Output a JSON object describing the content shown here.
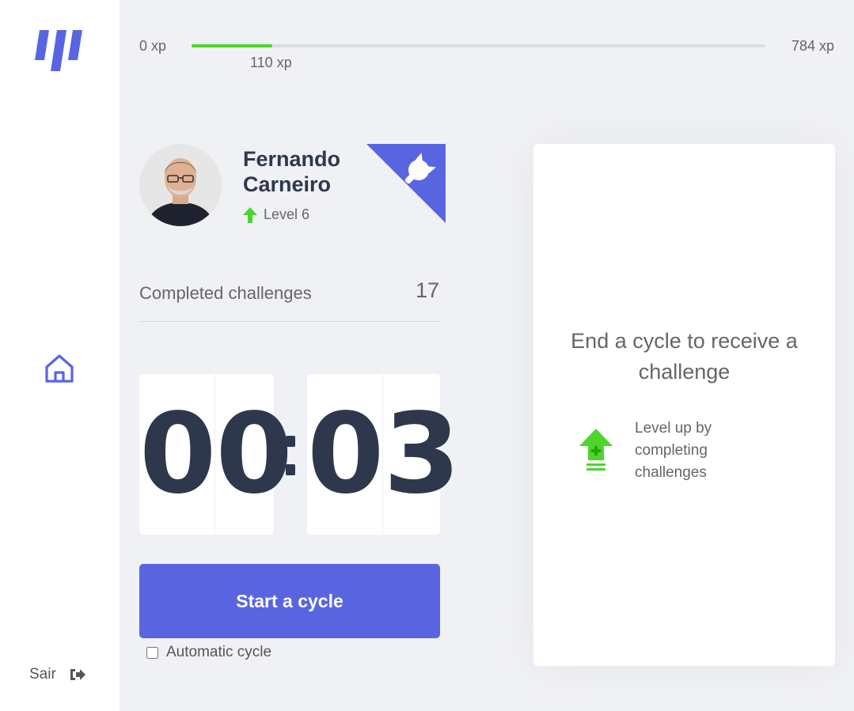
{
  "sidebar": {
    "logout_label": "Sair"
  },
  "xp": {
    "min_label": "0 xp",
    "max_label": "784 xp",
    "current_label": "110 xp",
    "progress_fraction": 0.14
  },
  "profile": {
    "name": "Fernando Carneiro",
    "level_label": "Level 6"
  },
  "completed": {
    "label": "Completed challenges",
    "value": "17"
  },
  "countdown": {
    "minute_left": "0",
    "minute_right": "0",
    "second_left": "0",
    "second_right": "3"
  },
  "actions": {
    "start_label": "Start a cycle",
    "auto_cycle_label": "Automatic cycle",
    "auto_cycle_checked": false
  },
  "challenge": {
    "title": "End a cycle to receive a challenge",
    "hint": "Level up by completing challenges"
  },
  "colors": {
    "accent": "#5965e0",
    "green": "#4cd62b",
    "title_text": "#2e384d",
    "body_text": "#666666",
    "background": "#f0f1f4"
  },
  "icons": {
    "logo": "moveit-logo-icon",
    "home": "home-icon",
    "logout": "logout-icon",
    "level": "level-up-arrow-icon",
    "github": "github-icon",
    "hint": "level-up-icon"
  }
}
